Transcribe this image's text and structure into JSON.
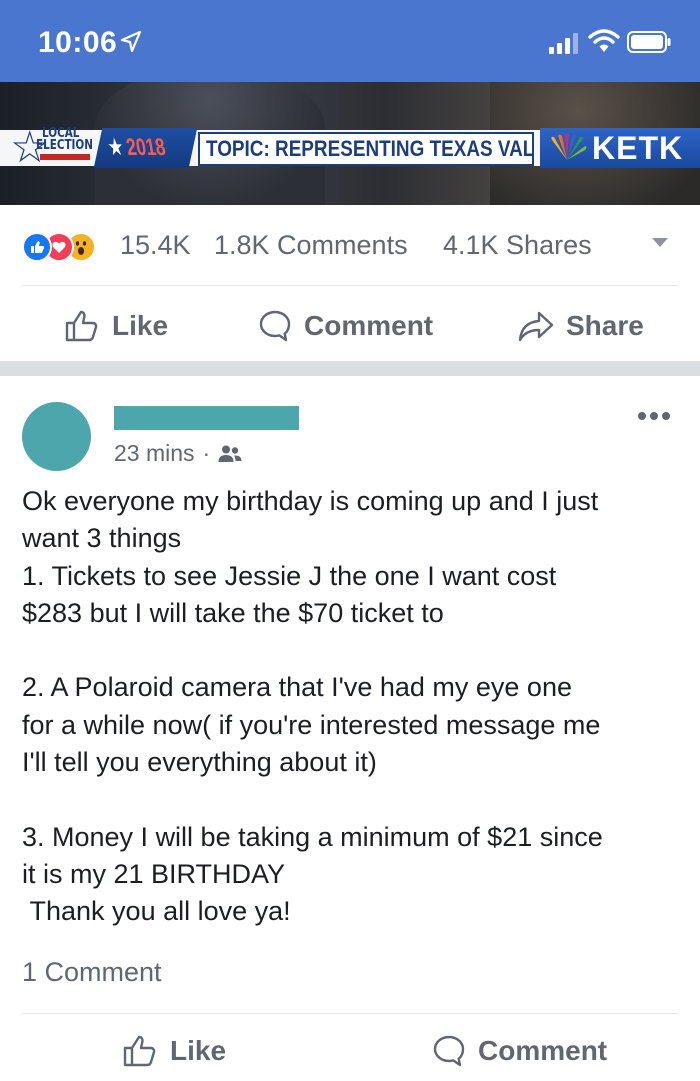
{
  "status_bar": {
    "time": "10:06",
    "icons": [
      "location-arrow-icon",
      "cellular-signal-icon",
      "wifi-icon",
      "battery-icon"
    ]
  },
  "video": {
    "local_line1": "LOCAL",
    "local_line2": "ELECTION",
    "year_prefix": "★",
    "year": "2018",
    "topic": "TOPIC: REPRESENTING TEXAS VALUES",
    "channel": "KETK"
  },
  "stats": {
    "reactions": [
      "like-reaction-icon",
      "love-reaction-icon",
      "wow-reaction-icon"
    ],
    "reaction_count": "15.4K",
    "comments": "1.8K Comments",
    "shares": "4.1K Shares"
  },
  "actions": {
    "like": "Like",
    "comment": "Comment",
    "share": "Share"
  },
  "post": {
    "time": "23 mins",
    "separator": "·",
    "audience_icon": "friends-icon",
    "body": "Ok everyone my birthday is coming up and I just\nwant 3 things\n1. Tickets to see Jessie J the one I want cost\n$283 but I will take the $70 ticket to\n\n2. A Polaroid camera that I've had my eye one\nfor a while now( if you're interested message me\nI'll tell you everything about it)\n\n3. Money I will be taking a minimum of $21 since\nit is my 21 BIRTHDAY\n Thank you all love ya!",
    "comment_count": "1 Comment",
    "like": "Like",
    "comment": "Comment"
  },
  "colors": {
    "status_bar": "#4a76cf",
    "avatar": "#4ea6ad",
    "text_secondary": "#606770",
    "like_blue": "#1877f2",
    "love_red": "#f33e58",
    "wow_yellow": "#f7b125"
  }
}
